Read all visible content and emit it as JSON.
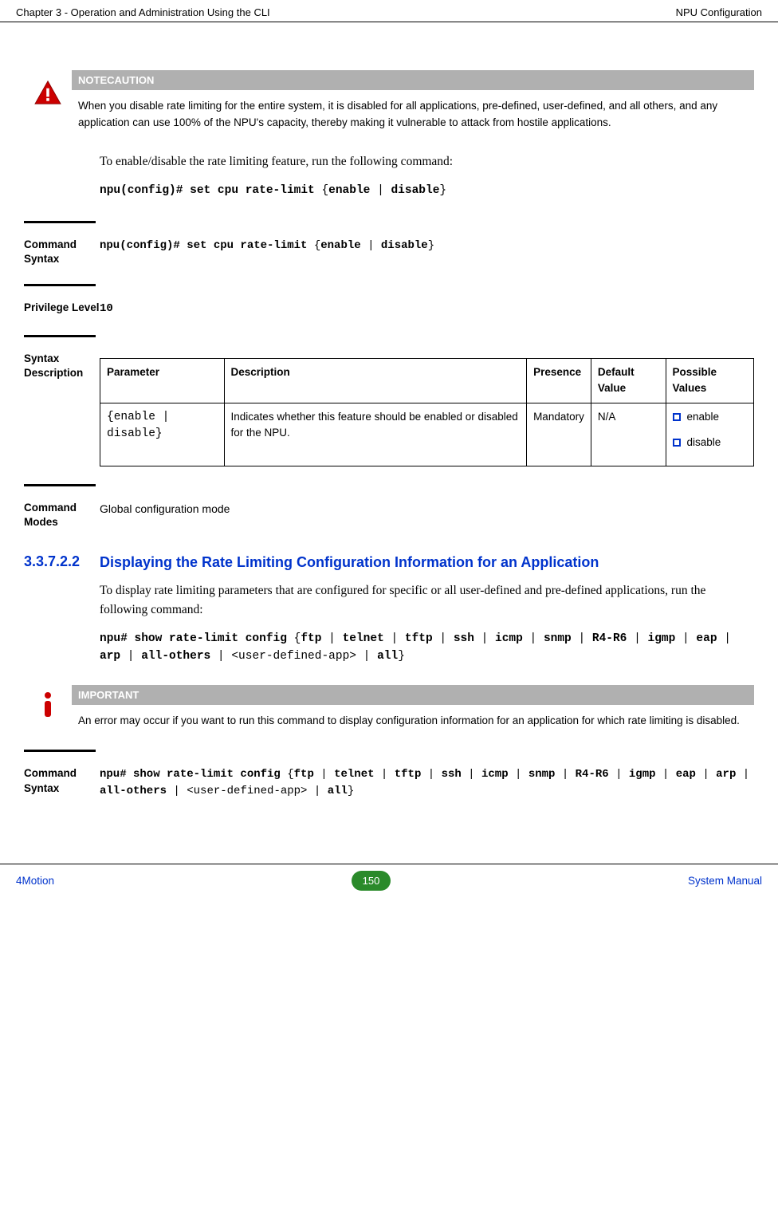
{
  "header": {
    "left": "Chapter 3 - Operation and Administration Using the CLI",
    "right": "NPU Configuration"
  },
  "noteCaution": {
    "title": "NOTECAUTION",
    "body": "When you disable rate limiting for the entire system, it is disabled for all applications, pre-defined, user-defined, and all others, and any application can use 100% of the NPU's capacity, thereby making it vulnerable to attack from hostile applications."
  },
  "intro1": "To enable/disable the rate limiting feature, run the following command:",
  "cmd1": {
    "prefix": "npu(config)# set cpu rate-limit ",
    "lbrace": "{",
    "enable": "enable",
    "pipe": " | ",
    "disable": "disable",
    "rbrace": "}"
  },
  "defs": {
    "commandSyntaxLabel": "Command Syntax",
    "privilegeLabel": "Privilege Level",
    "privilegeValue": "10",
    "syntaxDescLabel": "Syntax Description",
    "commandModesLabel": "Command Modes",
    "commandModesValue": "Global configuration mode"
  },
  "syntaxTable": {
    "headers": {
      "param": "Parameter",
      "desc": "Description",
      "presence": "Presence",
      "default": "Default Value",
      "possible": "Possible Values"
    },
    "row1": {
      "param": "{enable | disable}",
      "desc": "Indicates whether this feature should be enabled or disabled for the NPU.",
      "presence": "Mandatory",
      "default": "N/A",
      "possible1": "enable",
      "possible2": "disable"
    }
  },
  "section33722": {
    "num": "3.3.7.2.2",
    "title": "Displaying the Rate Limiting Configuration Information for an Application",
    "body": "To display rate limiting parameters that are configured for specific or all user-defined and pre-defined applications, run the following command:"
  },
  "cmd2": {
    "prefix": "npu# show rate-limit config ",
    "lbrace": "{",
    "ftp": "ftp",
    "telnet": "telnet",
    "tftp": "tftp",
    "ssh": "ssh",
    "icmp": "icmp",
    "snmp": "snmp",
    "r4r6": "R4-R6",
    "igmp": "igmp",
    "eap": "eap",
    "arp": "arp",
    "allothers": "all-others",
    "userapp": "<user-defined-app>",
    "all": "all",
    "pipe": " | ",
    "rbrace": "}"
  },
  "important": {
    "title": "IMPORTANT",
    "body": "An error may occur if you want to run this command to display configuration information for an application for which rate limiting is disabled."
  },
  "footer": {
    "left": "4Motion",
    "page": "150",
    "right": "System Manual"
  }
}
